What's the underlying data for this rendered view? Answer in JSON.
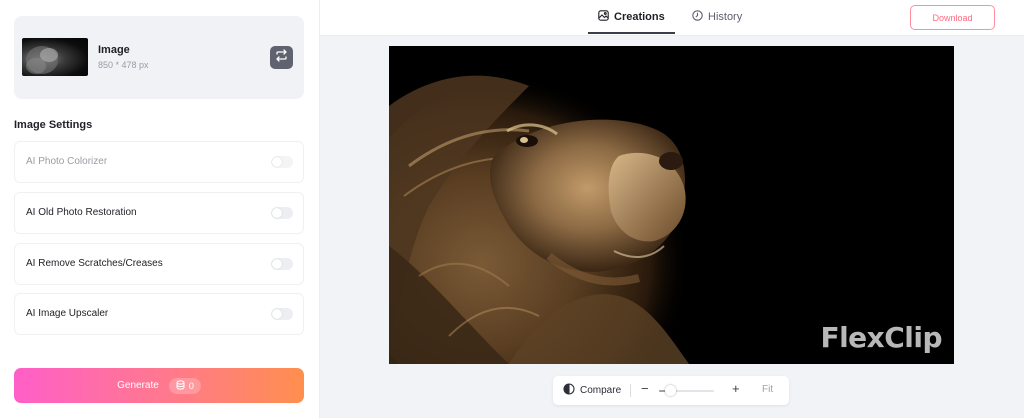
{
  "image_card": {
    "title": "Image",
    "dimensions": "850 * 478 px"
  },
  "settings": {
    "title": "Image Settings",
    "items": [
      {
        "label": "AI Photo Colorizer",
        "enabled": false,
        "disabled": true
      },
      {
        "label": "AI Old Photo Restoration",
        "enabled": false,
        "disabled": false
      },
      {
        "label": "AI Remove Scratches/Creases",
        "enabled": false,
        "disabled": false
      },
      {
        "label": "AI Image Upscaler",
        "enabled": false,
        "disabled": false
      }
    ]
  },
  "generate": {
    "label": "Generate",
    "credits": "0"
  },
  "tabs": [
    {
      "label": "Creations",
      "icon": "image-icon",
      "active": true
    },
    {
      "label": "History",
      "icon": "clock-icon",
      "active": false
    }
  ],
  "download_label": "Download",
  "watermark": "FlexClip",
  "zoom_bar": {
    "compare_label": "Compare",
    "zoom_level": 0.2,
    "fit_label": "Fit"
  },
  "colors": {
    "accent_pink": "#ff5fc8",
    "accent_orange": "#ff8f4e",
    "download_border": "#ff8fa0"
  }
}
